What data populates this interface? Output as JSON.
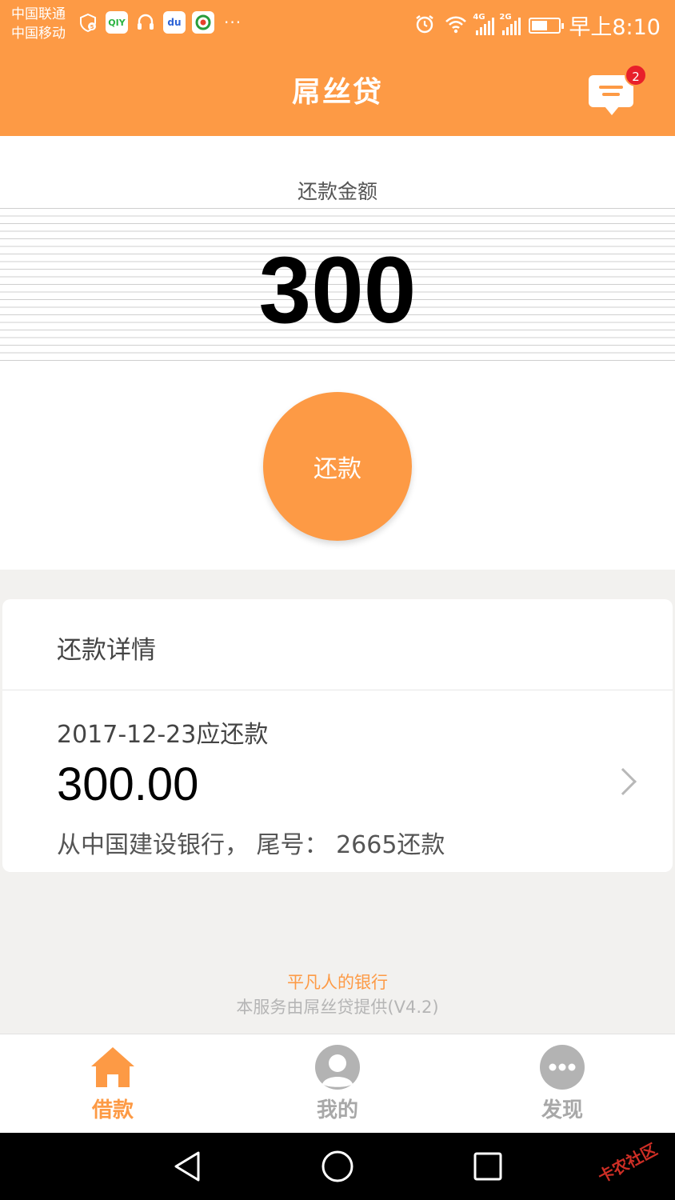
{
  "status_bar": {
    "carrier_1": "中国联通",
    "carrier_2": "中国移动",
    "app_icons": [
      "shield-icon",
      "iqiyi-icon",
      "headset-icon",
      "baidu-icon",
      "browser-icon"
    ],
    "iqiyi_text": "QIY",
    "baidu_text": "du",
    "more": "···",
    "net_1": "4G",
    "net_2": "2G",
    "clock": "早上8:10",
    "battery_level": 0.6
  },
  "header": {
    "title": "屌丝贷",
    "message_badge": "2"
  },
  "repayment": {
    "label": "还款金额",
    "amount": "300",
    "button_label": "还款"
  },
  "details": {
    "title": "还款详情",
    "due_date": "2017-12-23应还款",
    "amount": "300.00",
    "source": "从中国建设银行， 尾号：  2665还款"
  },
  "footer": {
    "slogan": "平凡人的银行",
    "provider": "本服务由屌丝贷提供(V4.2)"
  },
  "tabs": [
    {
      "label": "借款",
      "icon": "home-icon",
      "active": true
    },
    {
      "label": "我的",
      "icon": "user-icon",
      "active": false
    },
    {
      "label": "发现",
      "icon": "more-icon",
      "active": false
    }
  ],
  "nav": {
    "watermark": "卡农社区"
  },
  "colors": {
    "accent": "#fd9a45",
    "badge": "#e8202a",
    "inactive": "#a8a8a8"
  }
}
